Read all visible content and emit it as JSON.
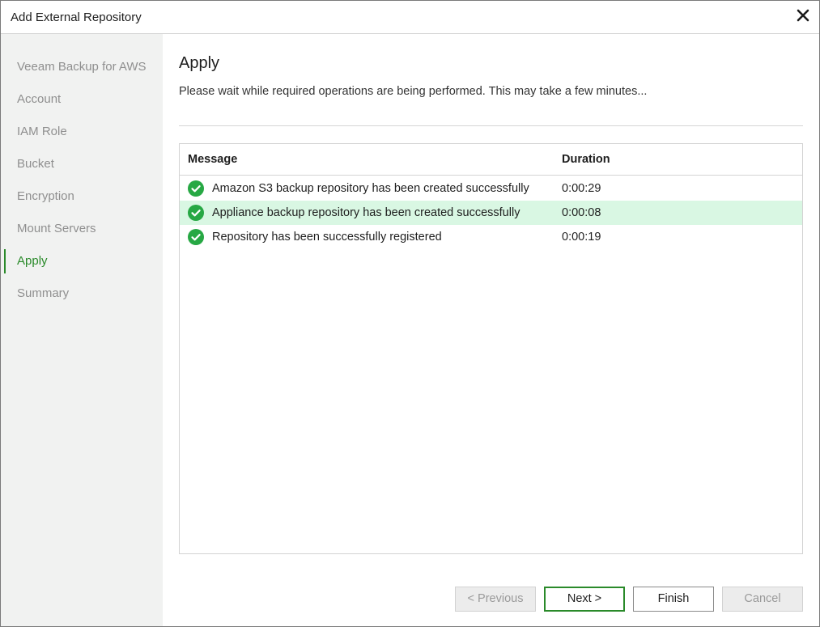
{
  "window": {
    "title": "Add External Repository",
    "close_icon": "close-icon"
  },
  "sidebar": {
    "items": [
      {
        "label": "Veeam Backup for AWS",
        "active": false
      },
      {
        "label": "Account",
        "active": false
      },
      {
        "label": "IAM Role",
        "active": false
      },
      {
        "label": "Bucket",
        "active": false
      },
      {
        "label": "Encryption",
        "active": false
      },
      {
        "label": "Mount Servers",
        "active": false
      },
      {
        "label": "Apply",
        "active": true
      },
      {
        "label": "Summary",
        "active": false
      }
    ]
  },
  "main": {
    "title": "Apply",
    "description": "Please wait while required operations are being performed. This may take a few minutes...",
    "table": {
      "columns": [
        "Message",
        "Duration"
      ],
      "rows": [
        {
          "status_icon": "success-check-icon",
          "message": "Amazon S3 backup repository has been created successfully",
          "duration": "0:00:29",
          "highlighted": false
        },
        {
          "status_icon": "success-check-icon",
          "message": "Appliance backup repository has been created successfully",
          "duration": "0:00:08",
          "highlighted": true
        },
        {
          "status_icon": "success-check-icon",
          "message": "Repository has been successfully registered",
          "duration": "0:00:19",
          "highlighted": false
        }
      ]
    }
  },
  "buttons": {
    "previous": {
      "label": "< Previous",
      "enabled": false
    },
    "next": {
      "label": "Next >",
      "enabled": true,
      "default": true
    },
    "finish": {
      "label": "Finish",
      "enabled": true
    },
    "cancel": {
      "label": "Cancel",
      "enabled": false
    }
  },
  "colors": {
    "accent_green": "#2a8a2a",
    "success_icon": "#27a844",
    "row_highlight": "#d9f7e3",
    "sidebar_bg": "#f1f2f1"
  }
}
